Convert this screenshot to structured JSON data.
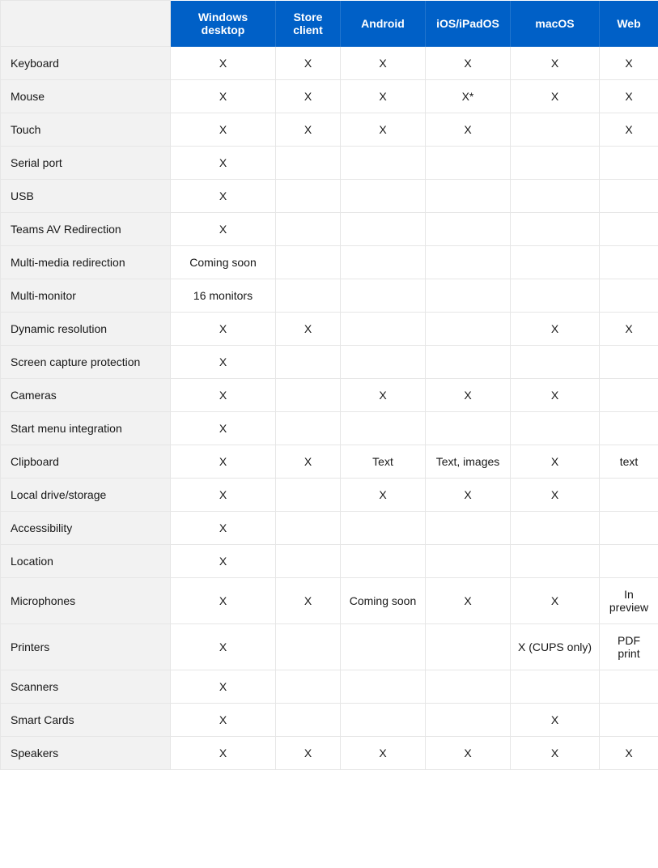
{
  "chart_data": {
    "type": "table",
    "columns": [
      "Windows desktop",
      "Store client",
      "Android",
      "iOS/iPadOS",
      "macOS",
      "Web"
    ],
    "rows": [
      {
        "label": "Keyboard",
        "values": [
          "X",
          "X",
          "X",
          "X",
          "X",
          "X"
        ]
      },
      {
        "label": "Mouse",
        "values": [
          "X",
          "X",
          "X",
          "X*",
          "X",
          "X"
        ]
      },
      {
        "label": "Touch",
        "values": [
          "X",
          "X",
          "X",
          "X",
          "",
          "X"
        ]
      },
      {
        "label": "Serial port",
        "values": [
          "X",
          "",
          "",
          "",
          "",
          ""
        ]
      },
      {
        "label": "USB",
        "values": [
          "X",
          "",
          "",
          "",
          "",
          ""
        ]
      },
      {
        "label": "Teams AV Redirection",
        "values": [
          "X",
          "",
          "",
          "",
          "",
          ""
        ]
      },
      {
        "label": "Multi-media redirection",
        "values": [
          "Coming soon",
          "",
          "",
          "",
          "",
          ""
        ]
      },
      {
        "label": "Multi-monitor",
        "values": [
          "16 monitors",
          "",
          "",
          "",
          "",
          ""
        ]
      },
      {
        "label": "Dynamic resolution",
        "values": [
          "X",
          "X",
          "",
          "",
          "X",
          "X"
        ]
      },
      {
        "label": "Screen capture protection",
        "values": [
          "X",
          "",
          "",
          "",
          "",
          ""
        ]
      },
      {
        "label": "Cameras",
        "values": [
          "X",
          "",
          "X",
          "X",
          "X",
          ""
        ]
      },
      {
        "label": "Start menu integration",
        "values": [
          "X",
          "",
          "",
          "",
          "",
          ""
        ]
      },
      {
        "label": "Clipboard",
        "values": [
          "X",
          "X",
          "Text",
          "Text, images",
          "X",
          "text"
        ]
      },
      {
        "label": "Local drive/storage",
        "values": [
          "X",
          "",
          "X",
          "X",
          "X",
          ""
        ]
      },
      {
        "label": "Accessibility",
        "values": [
          "X",
          "",
          "",
          "",
          "",
          ""
        ]
      },
      {
        "label": "Location",
        "values": [
          "X",
          "",
          "",
          "",
          "",
          ""
        ]
      },
      {
        "label": "Microphones",
        "values": [
          "X",
          "X",
          "Coming soon",
          "X",
          "X",
          "In preview"
        ]
      },
      {
        "label": "Printers",
        "values": [
          "X",
          "",
          "",
          "",
          "X (CUPS only)",
          "PDF print"
        ]
      },
      {
        "label": "Scanners",
        "values": [
          "X",
          "",
          "",
          "",
          "",
          ""
        ]
      },
      {
        "label": "Smart Cards",
        "values": [
          "X",
          "",
          "",
          "",
          "X",
          ""
        ]
      },
      {
        "label": "Speakers",
        "values": [
          "X",
          "X",
          "X",
          "X",
          "X",
          "X"
        ]
      }
    ]
  }
}
